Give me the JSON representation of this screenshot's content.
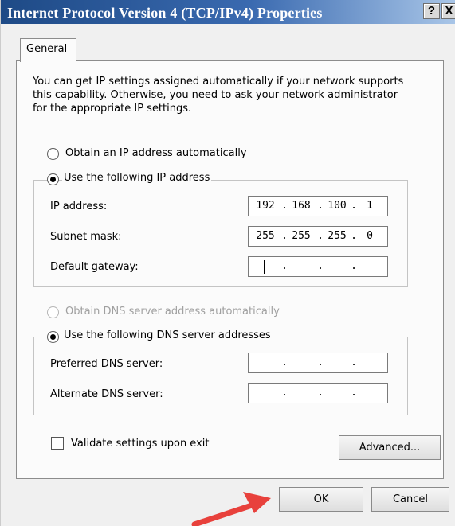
{
  "window": {
    "title": "Internet Protocol Version 4 (TCP/IPv4) Properties",
    "help_label": "?",
    "close_label": "X"
  },
  "tab": {
    "label": "General"
  },
  "description": "You can get IP settings assigned automatically if your network supports this capability. Otherwise, you need to ask your network administrator for the appropriate IP settings.",
  "ip_section": {
    "auto_label": "Obtain an IP address automatically",
    "manual_label": "Use the following IP address",
    "selected": "manual",
    "fields": [
      {
        "label": "IP address:",
        "octets": [
          "192",
          "168",
          "100",
          "1"
        ]
      },
      {
        "label": "Subnet mask:",
        "octets": [
          "255",
          "255",
          "255",
          "0"
        ]
      },
      {
        "label": "Default gateway:",
        "octets": [
          "",
          "",
          "",
          ""
        ]
      }
    ]
  },
  "dns_section": {
    "auto_label": "Obtain DNS server address automatically",
    "manual_label": "Use the following DNS server addresses",
    "selected": "manual",
    "auto_disabled": true,
    "fields": [
      {
        "label": "Preferred DNS server:",
        "octets": [
          "",
          "",
          "",
          ""
        ]
      },
      {
        "label": "Alternate DNS server:",
        "octets": [
          "",
          "",
          "",
          ""
        ]
      }
    ]
  },
  "validate": {
    "label": "Validate settings upon exit",
    "checked": false
  },
  "buttons": {
    "advanced": "Advanced...",
    "ok": "OK",
    "cancel": "Cancel"
  },
  "annotation": {
    "arrow_color": "#e8413c",
    "points_to": "ok-button"
  }
}
